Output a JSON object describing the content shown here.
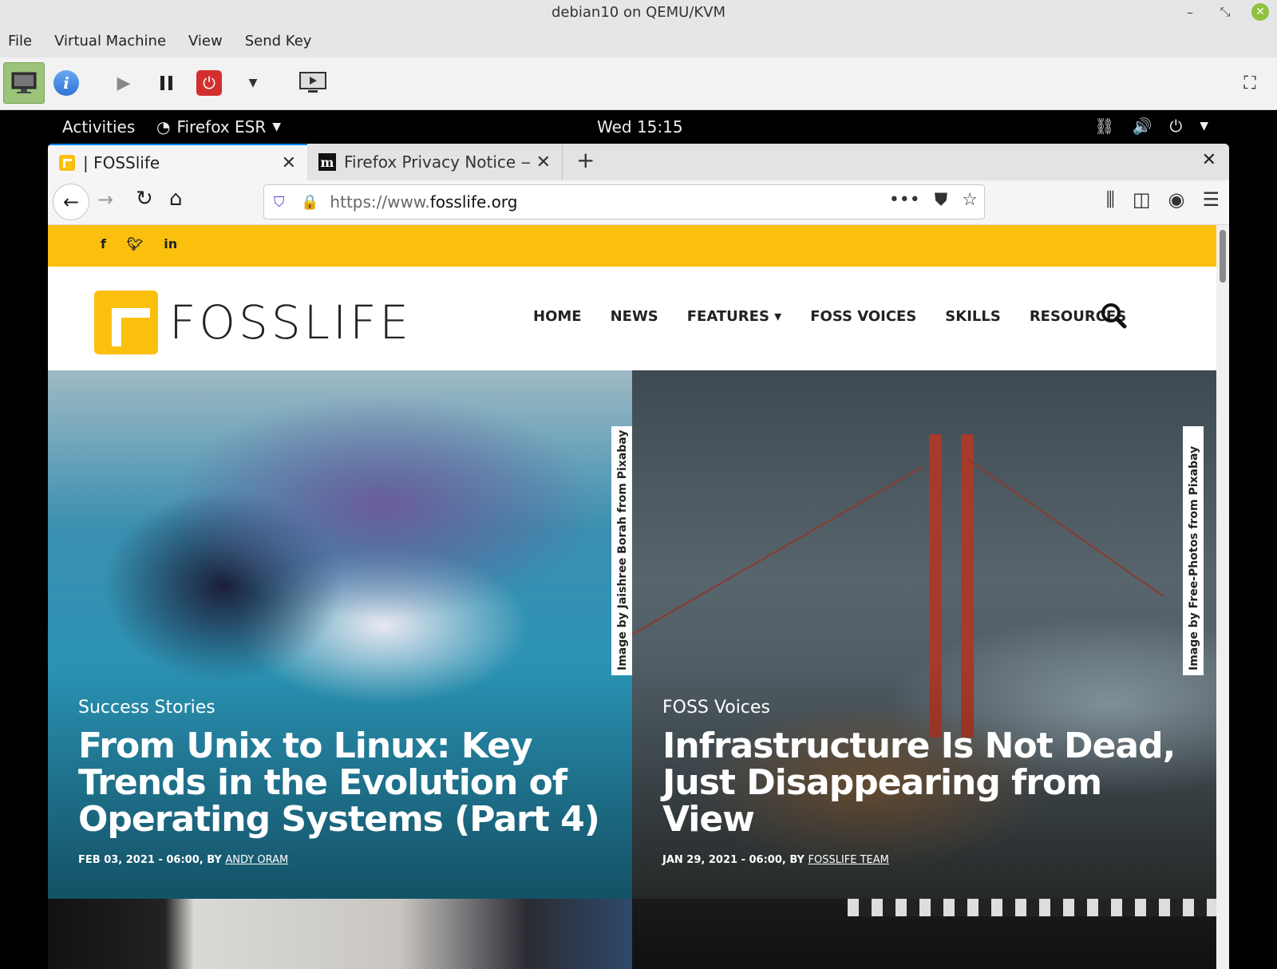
{
  "host": {
    "title": "debian10 on QEMU/KVM",
    "menu": [
      "File",
      "Virtual Machine",
      "View",
      "Send Key"
    ]
  },
  "gnome": {
    "activities": "Activities",
    "app_name": "Firefox ESR",
    "clock": "Wed 15:15"
  },
  "browser": {
    "tabs": [
      {
        "title": "| FOSSlife"
      },
      {
        "title": "Firefox Privacy Notice —"
      }
    ],
    "url_prefix": "https://www.",
    "url_domain": "fosslife.org"
  },
  "site": {
    "logo_text": "FOSSLIFE",
    "social": [
      "f",
      "t",
      "in"
    ],
    "nav": [
      "HOME",
      "NEWS",
      "FEATURES ▾",
      "FOSS VOICES",
      "SKILLS",
      "RESOURCES"
    ],
    "articles": [
      {
        "category": "Success Stories",
        "title": "From Unix to Linux: Key Trends in the Evolution of Operating Systems (Part 4)",
        "meta": "FEB 03, 2021 - 06:00, BY ",
        "author": "ANDY ORAM",
        "credit": "Image by Jaishree Borah from Pixabay"
      },
      {
        "category": "FOSS Voices",
        "title": "Infrastructure Is Not Dead, Just Disappearing from View",
        "meta": "JAN 29, 2021 - 06:00, BY ",
        "author": "FOSSLIFE TEAM",
        "credit": "Image by Free-Photos from Pixabay"
      }
    ]
  },
  "colors": {
    "brand_yellow": "#fbbf0e",
    "firefox_blue": "#0a84ff"
  }
}
